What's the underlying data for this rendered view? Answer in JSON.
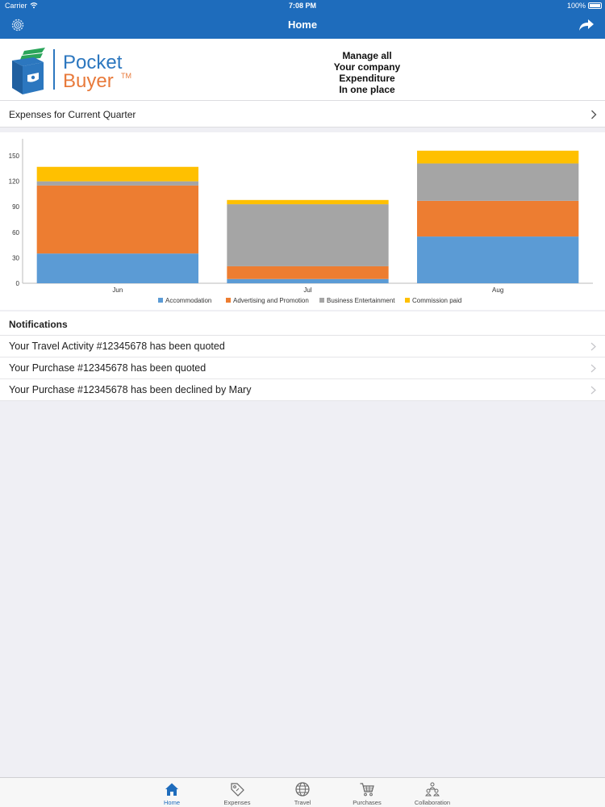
{
  "status_bar": {
    "carrier": "Carrier",
    "time": "7:08 PM",
    "battery": "100%"
  },
  "nav": {
    "title": "Home"
  },
  "banner": {
    "logo_line1": "Pocket",
    "logo_line2": "Buyer",
    "logo_tm": "TM",
    "tagline_lines": [
      "Manage all",
      "Your company",
      "Expenditure",
      "In one place"
    ]
  },
  "expenses": {
    "label": "Expenses for Current Quarter"
  },
  "chart_data": {
    "type": "bar",
    "stacked": true,
    "categories": [
      "Jun",
      "Jul",
      "Aug"
    ],
    "series": [
      {
        "name": "Accommodation",
        "color": "#5b9bd5",
        "values": [
          35,
          5,
          55
        ]
      },
      {
        "name": "Advertising and Promotion",
        "color": "#ed7d31",
        "values": [
          80,
          15,
          42
        ]
      },
      {
        "name": "Business Entertainment",
        "color": "#a5a5a5",
        "values": [
          5,
          73,
          44
        ]
      },
      {
        "name": "Commission paid",
        "color": "#ffc000",
        "values": [
          17,
          5,
          15
        ]
      }
    ],
    "yticks": [
      0,
      30,
      60,
      90,
      120,
      150
    ],
    "ylim": [
      0,
      170
    ],
    "legend": "bottom",
    "grid": false
  },
  "notifications": {
    "header": "Notifications",
    "items": [
      "Your Travel Activity #12345678 has been quoted",
      "Your Purchase #12345678 has been quoted",
      "Your Purchase #12345678 has been declined by Mary"
    ]
  },
  "tabs": [
    {
      "label": "Home",
      "icon": "home-icon",
      "active": true
    },
    {
      "label": "Expenses",
      "icon": "tag-icon",
      "active": false
    },
    {
      "label": "Travel",
      "icon": "globe-icon",
      "active": false
    },
    {
      "label": "Purchases",
      "icon": "cart-icon",
      "active": false
    },
    {
      "label": "Collaboration",
      "icon": "people-icon",
      "active": false
    }
  ],
  "colors": {
    "brand_blue": "#1e6cbc",
    "logo_orange": "#e87a3b",
    "logo_green": "#2aa55a"
  }
}
